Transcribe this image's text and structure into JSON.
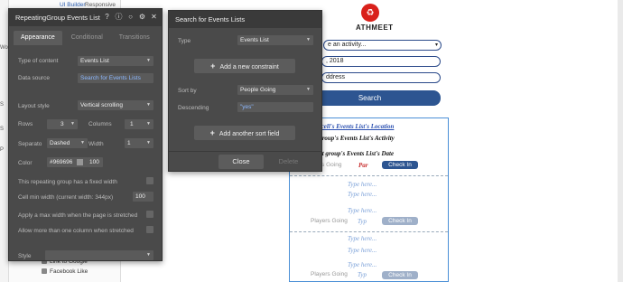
{
  "editor_tabs": {
    "ui_builder": "UI Builder",
    "responsive": "Responsive"
  },
  "sidebar_letters": [
    "Wo",
    "S",
    "S",
    "P"
  ],
  "elements_list": [
    "Link to Google",
    "Facebook Like"
  ],
  "page": {
    "brand": "ATHMEET",
    "activity_select": "e an activity...",
    "date_field": ", 2018",
    "address_field": "ddress",
    "search_button": "Search"
  },
  "repeating_group": {
    "cell1": {
      "location": "ent cell's Events List's Location",
      "activity": "Parent group's Events List's Activity",
      "date": "rent group's Events List's Date",
      "players_going": "yers Going",
      "par": "Par",
      "check_in": "Check In"
    },
    "cell2": {
      "type1": "Type here...",
      "type2": "Type here...",
      "type3": "Type here...",
      "players_going": "Players Going",
      "typ": "Typ",
      "check_in": "Check In"
    },
    "cell3": {
      "type1": "Type here...",
      "type2": "Type here...",
      "type3": "Type here...",
      "players_going": "Players Going",
      "typ": "Typ",
      "check_in": "Check In"
    }
  },
  "panel": {
    "title": "RepeatingGroup Events List",
    "tabs": [
      "Appearance",
      "Conditional",
      "Transitions"
    ],
    "type_of_content_label": "Type of content",
    "type_of_content_value": "Events List",
    "data_source_label": "Data source",
    "data_source_value": "Search for Events Lists",
    "layout_style_label": "Layout style",
    "layout_style_value": "Vertical scrolling",
    "rows_label": "Rows",
    "rows_value": "3",
    "columns_label": "Columns",
    "columns_value": "1",
    "separator_label": "Separato",
    "separator_value": "Dashed",
    "width_label": "Width",
    "width_value": "1",
    "color_label": "Color",
    "color_value": "#969696",
    "opacity_value": "100",
    "fixed_width_label": "This repeating group has a fixed width",
    "cell_min_width_label": "Cell min width (current width: 344px)",
    "cell_min_width_value": "100",
    "max_width_label": "Apply a max width when the page is stretched",
    "multi_column_label": "Allow more than one column when stretched",
    "style_label": "Style"
  },
  "search_popup": {
    "title": "Search for Events Lists",
    "type_label": "Type",
    "type_value": "Events List",
    "add_constraint": "Add a new constraint",
    "sort_by_label": "Sort by",
    "sort_by_value": "People Going",
    "descending_label": "Descending",
    "descending_value": "\"yes\"",
    "add_sort_field": "Add another sort field",
    "close": "Close",
    "delete": "Delete"
  },
  "colors": {
    "accent_blue": "#2d5591",
    "panel_bg": "#4a4a4a",
    "logo_red": "#d9211b",
    "swatch": "#969696"
  }
}
